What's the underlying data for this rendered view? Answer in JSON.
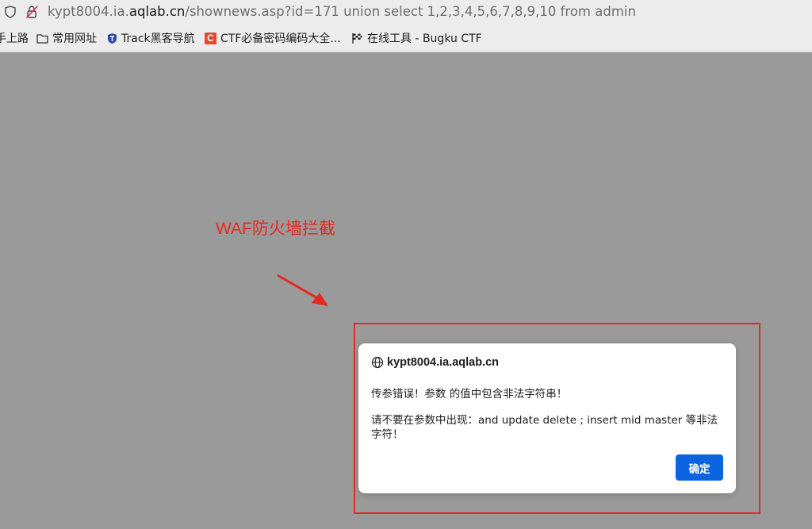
{
  "browser": {
    "url_prefix": "kypt8004.ia.",
    "url_domain": "aqlab.cn",
    "url_suffix": "/shownews.asp?id=171 union select 1,2,3,4,5,6,7,8,9,10 from admin",
    "bookmarks": [
      {
        "label": "手上路",
        "icon": "none"
      },
      {
        "label": "常用网址",
        "icon": "folder-icon"
      },
      {
        "label": "Track黑客导航",
        "icon": "shield-icon"
      },
      {
        "label": "CTF必备密码编码大全...",
        "icon": "c-logo-icon"
      },
      {
        "label": "在线工具 - Bugku CTF",
        "icon": "flag-icon"
      }
    ]
  },
  "annotation": {
    "text": "WAF防火墙拦截",
    "color": "#e42a22"
  },
  "dialog": {
    "host": "kypt8004.ia.aqlab.cn",
    "message_line1": "传参错误！参数  的值中包含非法字符串！",
    "message_line2": "请不要在参数中出现：and update delete ; insert mid master 等非法字符！",
    "ok_label": "确定",
    "button_color": "#0a64e0"
  }
}
